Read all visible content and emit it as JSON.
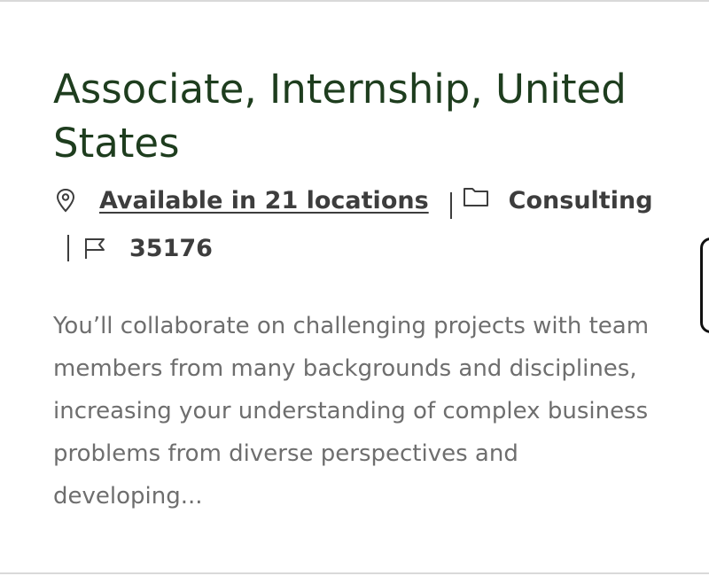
{
  "job": {
    "title": "Associate, Internship, United States",
    "locations_label": "Available in 21 locations",
    "category": "Consulting",
    "job_id": "35176",
    "description": "You’ll collaborate on challenging projects with team members from many backgrounds and disciplines, increasing your understanding of complex business problems from diverse perspectives and developing..."
  },
  "icons": {
    "location": "map-pin-icon",
    "category": "folder-icon",
    "job_id": "flag-icon"
  },
  "colors": {
    "title": "#1e3d1e",
    "meta_text": "#3d3d3d",
    "description": "#6e6e6e",
    "divider": "#d9d9d9"
  }
}
